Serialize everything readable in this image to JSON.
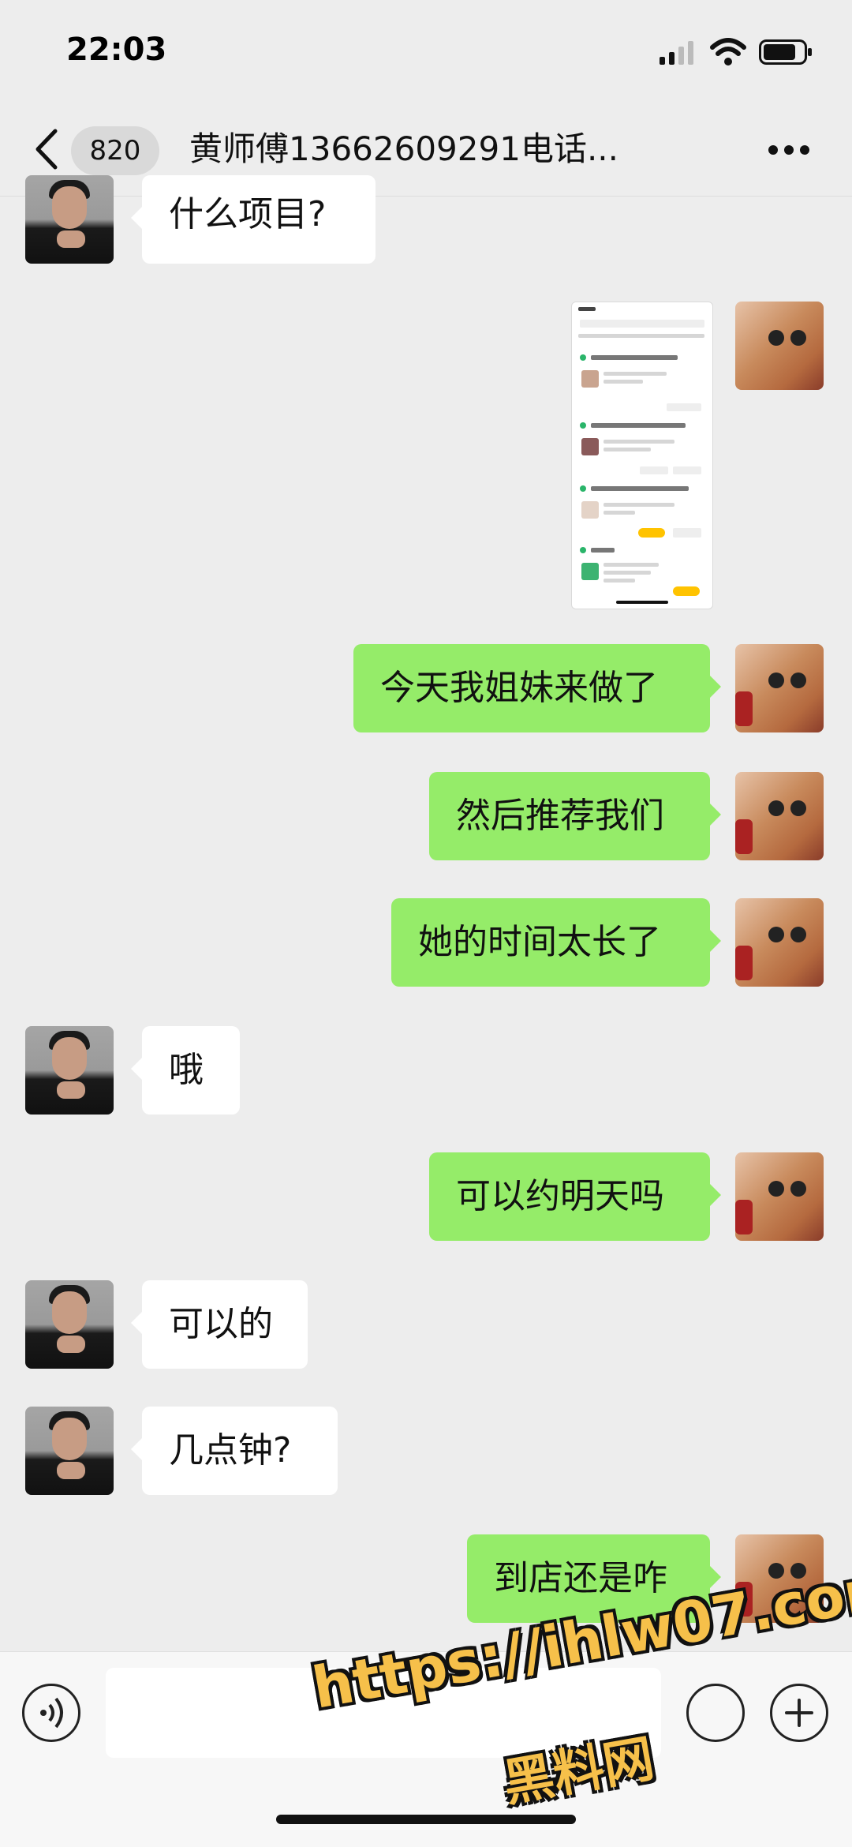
{
  "status_bar": {
    "time": "22:03"
  },
  "header": {
    "unread_count": "820",
    "title": "黄师傅13662609291电话..."
  },
  "messages": [
    {
      "side": "received",
      "text": "什么项目?"
    },
    {
      "side": "sent",
      "type": "image",
      "text": ""
    },
    {
      "side": "sent",
      "text": "今天我姐妹来做了"
    },
    {
      "side": "sent",
      "text": "然后推荐我们"
    },
    {
      "side": "sent",
      "text": "她的时间太长了"
    },
    {
      "side": "received",
      "text": "哦"
    },
    {
      "side": "sent",
      "text": "可以约明天吗"
    },
    {
      "side": "received",
      "text": "可以的"
    },
    {
      "side": "received",
      "text": "几点钟?"
    },
    {
      "side": "sent",
      "text": "到店还是咋"
    }
  ],
  "input_bar": {
    "value": ""
  },
  "watermark": {
    "url": "https://ihlw07.com",
    "name": "黑料网"
  },
  "colors": {
    "background": "#ededed",
    "sent_bubble": "#95ec69",
    "received_bubble": "#ffffff"
  },
  "icons": [
    "back-icon",
    "more-icon",
    "voice-icon",
    "emoji-icon",
    "plus-icon"
  ]
}
